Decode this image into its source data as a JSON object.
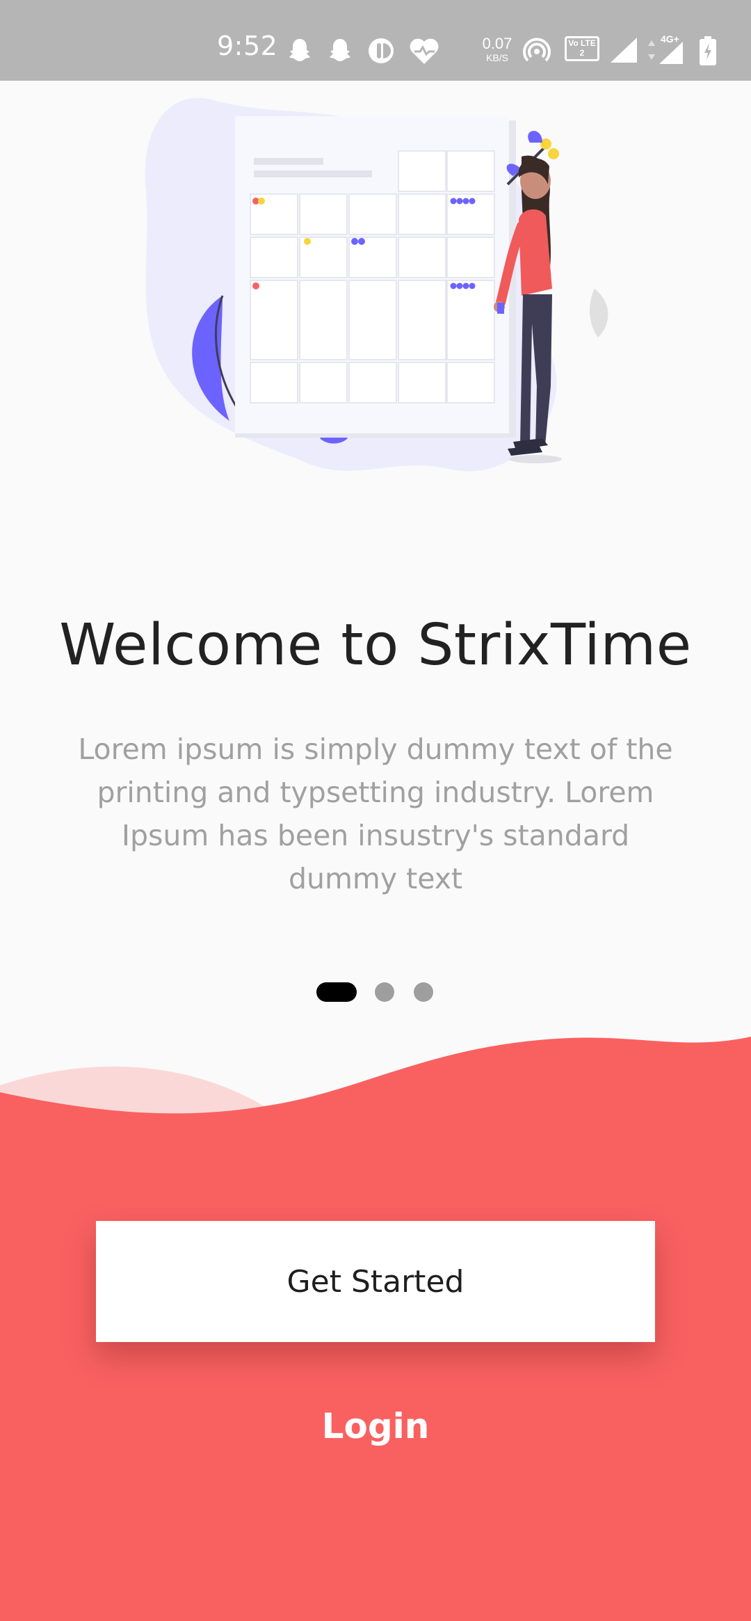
{
  "status_bar": {
    "time": "9:52",
    "net_speed_value": "0.07",
    "net_speed_unit": "KB/S",
    "volte_label": "Vo LTE 2",
    "network_type": "4G+",
    "icons": [
      "snapchat-icon",
      "snapchat-icon",
      "app-icon",
      "health-heart-icon",
      "hotspot-icon",
      "volte-icon",
      "signal-icon",
      "signal-4g-icon",
      "battery-charging-icon"
    ]
  },
  "onboarding": {
    "title": "Welcome to StrixTime",
    "description": "Lorem ipsum is simply dummy text of the printing and typsetting industry. Lorem Ipsum has been insustry's standard dummy text",
    "page_indicator": {
      "total": 3,
      "active_index": 0
    }
  },
  "actions": {
    "get_started_label": "Get Started",
    "login_label": "Login"
  },
  "colors": {
    "accent": "#f96161",
    "illustration_purple": "#6c63ff",
    "status_bar": "#b5b5b5"
  }
}
